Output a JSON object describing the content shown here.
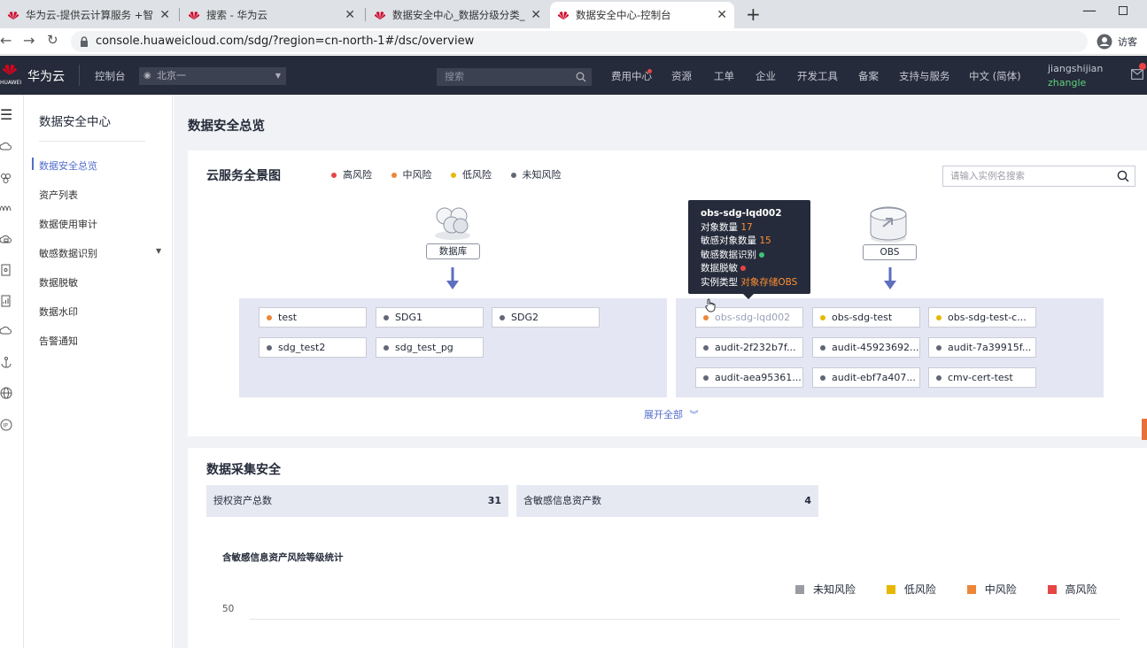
{
  "browser": {
    "tabs": [
      {
        "title": "华为云-提供云计算服务 +智能,",
        "active": false
      },
      {
        "title": "搜索 - 华为云",
        "active": false
      },
      {
        "title": "数据安全中心_数据分级分类_数据",
        "active": false
      },
      {
        "title": "数据安全中心-控制台",
        "active": true
      }
    ],
    "new_tab": "+",
    "url": "console.huaweicloud.com/sdg/?region=cn-north-1#/dsc/overview",
    "profile_label": "访客"
  },
  "topnav": {
    "brand_small": "HUAWEI",
    "brand": "华为云",
    "console": "控制台",
    "region": "北京一",
    "search_placeholder": "搜索",
    "items": [
      "费用中心",
      "资源",
      "工单",
      "企业",
      "开发工具",
      "备案",
      "支持与服务",
      "中文 (简体)"
    ],
    "user": "jiangshijian",
    "user_sub": "zhangle",
    "colors": {
      "bar": "#252b3a",
      "user_sub": "#5ed17a",
      "alert": "#e64545"
    }
  },
  "sidebar": {
    "title": "数据安全中心",
    "items": [
      {
        "label": "数据安全总览",
        "active": true
      },
      {
        "label": "资产列表"
      },
      {
        "label": "数据使用审计"
      },
      {
        "label": "敏感数据识别",
        "expandable": true
      },
      {
        "label": "数据脱敏"
      },
      {
        "label": "数据水印"
      },
      {
        "label": "告警通知"
      }
    ],
    "active_color": "#526ecc"
  },
  "page_title": "数据安全总览",
  "panorama": {
    "title": "云服务全景图",
    "legend": [
      {
        "label": "高风险",
        "color": "#e64545"
      },
      {
        "label": "中风险",
        "color": "#ed8639"
      },
      {
        "label": "低风险",
        "color": "#e6b800"
      },
      {
        "label": "未知风险",
        "color": "#626776"
      }
    ],
    "search_placeholder": "请输入实例名搜索",
    "groups": [
      {
        "label": "数据库",
        "instances": [
          {
            "name": "test",
            "risk": "#ed8639"
          },
          {
            "name": "SDG1",
            "risk": "#626776"
          },
          {
            "name": "SDG2",
            "risk": "#626776"
          },
          {
            "name": "sdg_test2",
            "risk": "#626776"
          },
          {
            "name": "sdg_test_pg",
            "risk": "#626776"
          }
        ]
      },
      {
        "label": "OBS",
        "instances": [
          {
            "name": "obs-sdg-lqd002",
            "risk": "#ed8639"
          },
          {
            "name": "obs-sdg-test",
            "risk": "#e6b800"
          },
          {
            "name": "obs-sdg-test-c...",
            "risk": "#e6b800"
          },
          {
            "name": "audit-2f232b7f...",
            "risk": "#626776"
          },
          {
            "name": "audit-45923692...",
            "risk": "#626776"
          },
          {
            "name": "audit-7a39915f...",
            "risk": "#626776"
          },
          {
            "name": "audit-aea95361...",
            "risk": "#626776"
          },
          {
            "name": "audit-ebf7a407...",
            "risk": "#626776"
          },
          {
            "name": "cmv-cert-test",
            "risk": "#626776"
          }
        ]
      }
    ],
    "expand_label": "展开全部",
    "tooltip": {
      "title": "obs-sdg-lqd002",
      "object_count_label": "对象数量",
      "object_count": "17",
      "sensitive_count_label": "敏感对象数量",
      "sensitive_count": "15",
      "recognition_label": "敏感数据识别",
      "masking_label": "数据脱敏",
      "type_label": "实例类型",
      "type_value": "对象存储OBS",
      "recognition_color": "#3ec379",
      "masking_color": "#e64545"
    }
  },
  "collection": {
    "title": "数据采集安全",
    "stats": [
      {
        "label": "授权资产总数",
        "value": "31"
      },
      {
        "label": "含敏感信息资产数",
        "value": "4"
      }
    ],
    "chart": {
      "title": "含敏感信息资产风险等级统计",
      "legend": [
        {
          "label": "未知风险",
          "color": "#9a9ca3"
        },
        {
          "label": "低风险",
          "color": "#e6b800"
        },
        {
          "label": "中风险",
          "color": "#ed8639"
        },
        {
          "label": "高风险",
          "color": "#e64545"
        }
      ],
      "y_tick": "50"
    }
  }
}
